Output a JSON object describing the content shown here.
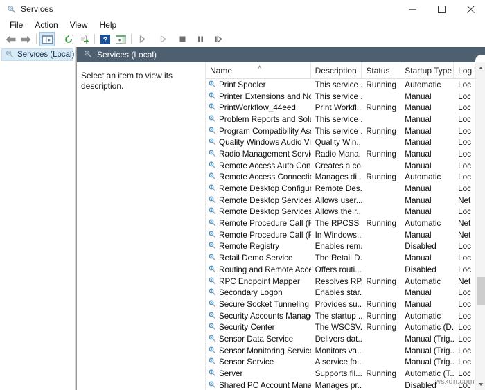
{
  "window": {
    "title": "Services",
    "icon": "services-gear-icon",
    "controls": {
      "minimize": "minimize-icon",
      "maximize": "maximize-icon",
      "close": "close-icon"
    }
  },
  "menubar": {
    "items": [
      {
        "label": "File"
      },
      {
        "label": "Action"
      },
      {
        "label": "View"
      },
      {
        "label": "Help"
      }
    ]
  },
  "toolbar": {
    "buttons": [
      {
        "name": "back-icon",
        "title": "Back"
      },
      {
        "name": "forward-icon",
        "title": "Forward"
      },
      {
        "name": "show-hide-console-tree-icon",
        "title": "Show/Hide Console Tree",
        "pressed": true
      },
      {
        "name": "refresh-icon",
        "title": "Refresh"
      },
      {
        "name": "export-list-icon",
        "title": "Export List"
      },
      {
        "name": "help-icon",
        "title": "Help"
      },
      {
        "name": "show-hide-action-pane-icon",
        "title": "Show/Hide Action Pane"
      },
      {
        "name": "start-service-icon",
        "title": "Start Service"
      },
      {
        "name": "resume-service-icon",
        "title": "Resume Service"
      },
      {
        "name": "stop-service-icon",
        "title": "Stop Service"
      },
      {
        "name": "pause-service-icon",
        "title": "Pause Service"
      },
      {
        "name": "restart-service-icon",
        "title": "Restart Service"
      }
    ]
  },
  "tree": {
    "items": [
      {
        "label": "Services (Local)",
        "icon": "services-gear-icon",
        "selected": true
      }
    ]
  },
  "pane": {
    "header_title": "Services (Local)",
    "header_icon": "services-gear-icon",
    "header_bg": "#4e5f70",
    "description_hint": "Select an item to view its description."
  },
  "list": {
    "columns": [
      {
        "label": "Name",
        "sorted": "asc",
        "caret": "˄"
      },
      {
        "label": "Description"
      },
      {
        "label": "Status"
      },
      {
        "label": "Startup Type"
      },
      {
        "label": "Log",
        "caret": "˄"
      }
    ],
    "rows": [
      {
        "name": "Print Spooler",
        "description": "This service ...",
        "status": "Running",
        "startup": "Automatic",
        "logon": "Loc"
      },
      {
        "name": "Printer Extensions and Notif...",
        "description": "This service ...",
        "status": "",
        "startup": "Manual",
        "logon": "Loc"
      },
      {
        "name": "PrintWorkflow_44eed",
        "description": "Print Workfl...",
        "status": "Running",
        "startup": "Manual",
        "logon": "Loc"
      },
      {
        "name": "Problem Reports and Soluti...",
        "description": "This service ...",
        "status": "",
        "startup": "Manual",
        "logon": "Loc"
      },
      {
        "name": "Program Compatibility Assi...",
        "description": "This service ...",
        "status": "Running",
        "startup": "Manual",
        "logon": "Loc"
      },
      {
        "name": "Quality Windows Audio Vid...",
        "description": "Quality Win...",
        "status": "",
        "startup": "Manual",
        "logon": "Loc"
      },
      {
        "name": "Radio Management Service",
        "description": "Radio Mana...",
        "status": "Running",
        "startup": "Manual",
        "logon": "Loc"
      },
      {
        "name": "Remote Access Auto Conne...",
        "description": "Creates a co...",
        "status": "",
        "startup": "Manual",
        "logon": "Loc"
      },
      {
        "name": "Remote Access Connection...",
        "description": "Manages di...",
        "status": "Running",
        "startup": "Automatic",
        "logon": "Loc"
      },
      {
        "name": "Remote Desktop Configurat...",
        "description": "Remote Des...",
        "status": "",
        "startup": "Manual",
        "logon": "Loc"
      },
      {
        "name": "Remote Desktop Services",
        "description": "Allows user...",
        "status": "",
        "startup": "Manual",
        "logon": "Net"
      },
      {
        "name": "Remote Desktop Services U...",
        "description": "Allows the r...",
        "status": "",
        "startup": "Manual",
        "logon": "Loc"
      },
      {
        "name": "Remote Procedure Call (RPC)",
        "description": "The RPCSS ...",
        "status": "Running",
        "startup": "Automatic",
        "logon": "Net"
      },
      {
        "name": "Remote Procedure Call (RP...",
        "description": "In Windows...",
        "status": "",
        "startup": "Manual",
        "logon": "Net"
      },
      {
        "name": "Remote Registry",
        "description": "Enables rem...",
        "status": "",
        "startup": "Disabled",
        "logon": "Loc"
      },
      {
        "name": "Retail Demo Service",
        "description": "The Retail D...",
        "status": "",
        "startup": "Manual",
        "logon": "Loc"
      },
      {
        "name": "Routing and Remote Access",
        "description": "Offers routi...",
        "status": "",
        "startup": "Disabled",
        "logon": "Loc"
      },
      {
        "name": "RPC Endpoint Mapper",
        "description": "Resolves RP...",
        "status": "Running",
        "startup": "Automatic",
        "logon": "Net"
      },
      {
        "name": "Secondary Logon",
        "description": "Enables star...",
        "status": "",
        "startup": "Manual",
        "logon": "Loc"
      },
      {
        "name": "Secure Socket Tunneling Pr...",
        "description": "Provides su...",
        "status": "Running",
        "startup": "Manual",
        "logon": "Loc"
      },
      {
        "name": "Security Accounts Manager",
        "description": "The startup ...",
        "status": "Running",
        "startup": "Automatic",
        "logon": "Loc"
      },
      {
        "name": "Security Center",
        "description": "The WSCSV...",
        "status": "Running",
        "startup": "Automatic (D...",
        "logon": "Loc"
      },
      {
        "name": "Sensor Data Service",
        "description": "Delivers dat...",
        "status": "",
        "startup": "Manual (Trig...",
        "logon": "Loc"
      },
      {
        "name": "Sensor Monitoring Service",
        "description": "Monitors va...",
        "status": "",
        "startup": "Manual (Trig...",
        "logon": "Loc"
      },
      {
        "name": "Sensor Service",
        "description": "A service fo...",
        "status": "",
        "startup": "Manual (Trig...",
        "logon": "Loc"
      },
      {
        "name": "Server",
        "description": "Supports fil...",
        "status": "Running",
        "startup": "Automatic (T...",
        "logon": "Loc"
      },
      {
        "name": "Shared PC Account Manager",
        "description": "Manages pr...",
        "status": "",
        "startup": "Disabled",
        "logon": "Loc"
      }
    ]
  },
  "scrollbar": {
    "up_arrow": "scroll-up-icon",
    "down_arrow": "scroll-down-icon"
  },
  "watermark": {
    "text": "wsxdn.com"
  }
}
